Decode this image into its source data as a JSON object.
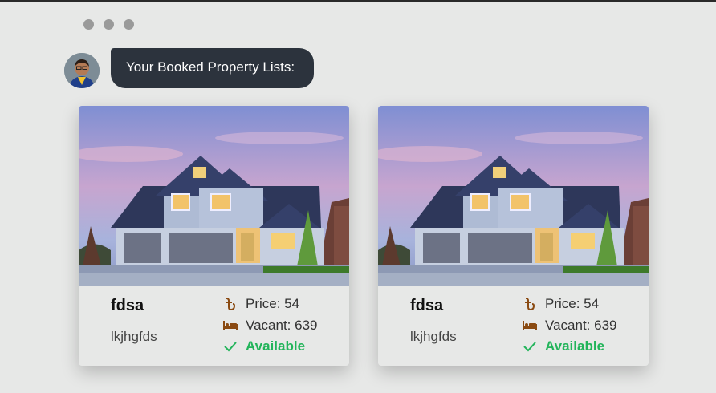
{
  "header": {
    "message": "Your Booked Property Lists:"
  },
  "cards": [
    {
      "title": "fdsa",
      "subtitle": "lkjhgfds",
      "price": "Price: 54",
      "vacant": "Vacant: 639",
      "status": "Available"
    },
    {
      "title": "fdsa",
      "subtitle": "lkjhgfds",
      "price": "Price: 54",
      "vacant": "Vacant: 639",
      "status": "Available"
    }
  ],
  "colors": {
    "bubble": "#2c333d",
    "available": "#22b45a",
    "icon": "#8a4a12"
  },
  "icons": [
    "taka-icon",
    "bed-icon",
    "check-icon"
  ]
}
